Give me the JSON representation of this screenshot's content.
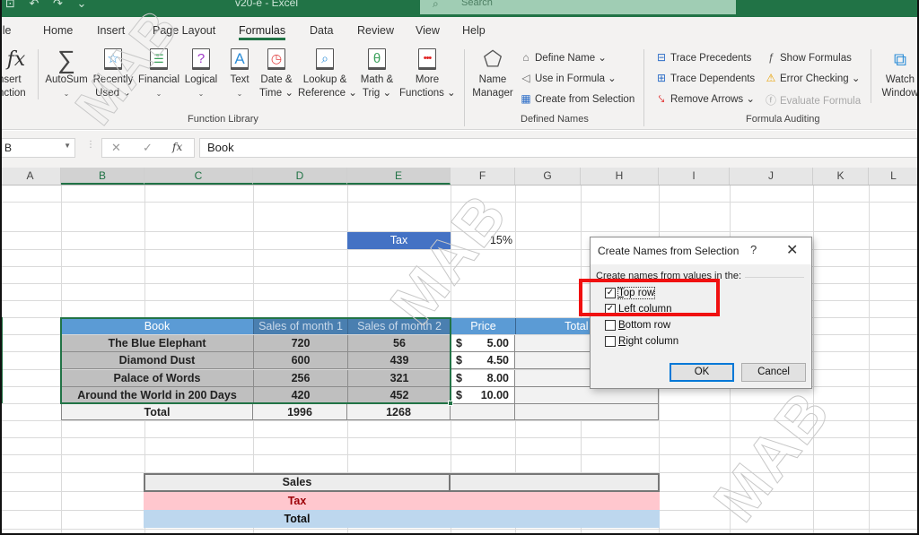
{
  "titlebar": {
    "quick_access": "⊡ ↶ ↷ ⌄",
    "title": "v20-e  -  Excel",
    "search_placeholder": "Search"
  },
  "ribbon": {
    "tabs": [
      {
        "label": "ile"
      },
      {
        "label": "Home"
      },
      {
        "label": "Insert"
      },
      {
        "label": "Page Layout"
      },
      {
        "label": "Formulas",
        "active": true
      },
      {
        "label": "Data"
      },
      {
        "label": "Review"
      },
      {
        "label": "View"
      },
      {
        "label": "Help"
      }
    ],
    "function_library": {
      "group_label": "Function Library",
      "insert_function": {
        "line1": "nsert",
        "line2": "nction",
        "icon": "fx"
      },
      "buttons": [
        {
          "line1": "AutoSum",
          "line2": "⌄",
          "icon": "sigma-icon"
        },
        {
          "line1": "Recently",
          "line2": "Used ⌄",
          "icon": "star-book-icon"
        },
        {
          "line1": "Financial",
          "line2": "⌄",
          "icon": "coins-book-icon"
        },
        {
          "line1": "Logical",
          "line2": "⌄",
          "icon": "question-book-icon"
        },
        {
          "line1": "Text",
          "line2": "⌄",
          "icon": "text-book-icon"
        },
        {
          "line1": "Date &",
          "line2": "Time ⌄",
          "icon": "clock-book-icon"
        },
        {
          "line1": "Lookup &",
          "line2": "Reference ⌄",
          "icon": "magnifier-book-icon"
        },
        {
          "line1": "Math &",
          "line2": "Trig ⌄",
          "icon": "theta-book-icon"
        },
        {
          "line1": "More",
          "line2": "Functions ⌄",
          "icon": "dots-book-icon"
        }
      ]
    },
    "defined_names": {
      "group_label": "Defined Names",
      "name_manager": {
        "line1": "Name",
        "line2": "Manager"
      },
      "define_name": "Define Name  ⌄",
      "use_in_formula": "Use in Formula ⌄",
      "create_from_selection": "Create from Selection"
    },
    "formula_auditing": {
      "group_label": "Formula Auditing",
      "trace_precedents": "Trace Precedents",
      "trace_dependents": "Trace Dependents",
      "remove_arrows": "Remove Arrows  ⌄",
      "show_formulas": "Show Formulas",
      "error_checking": "Error Checking  ⌄",
      "evaluate_formula": "Evaluate Formula"
    },
    "watch_window": {
      "line1": "Watch",
      "line2": "Window"
    }
  },
  "formula_bar": {
    "name_box": "B",
    "cancel": "✕",
    "enter": "✓",
    "fx": "fx",
    "value": "Book"
  },
  "columns": [
    "A",
    "B",
    "C",
    "D",
    "E",
    "F",
    "G",
    "H",
    "I",
    "J",
    "K",
    "L"
  ],
  "sheet": {
    "tax_label": "Tax",
    "tax_value": "15%",
    "table_headers": {
      "book": "Book",
      "sales_m1": "Sales of month 1",
      "sales_m2": "Sales of month 2",
      "price": "Price",
      "total_books": "Total boo"
    },
    "rows": [
      {
        "book": "The Blue Elephant",
        "m1": "720",
        "m2": "56",
        "currency": "$",
        "price": "5.00"
      },
      {
        "book": "Diamond Dust",
        "m1": "600",
        "m2": "439",
        "currency": "$",
        "price": "4.50"
      },
      {
        "book": "Palace of Words",
        "m1": "256",
        "m2": "321",
        "currency": "$",
        "price": "8.00"
      },
      {
        "book": "Around the World in 200 Days",
        "m1": "420",
        "m2": "452",
        "currency": "$",
        "price": "10.00"
      }
    ],
    "total_row": {
      "label": "Total",
      "m1": "1996",
      "m2": "1268"
    },
    "summary": {
      "sales": "Sales",
      "tax": "Tax",
      "total": "Total"
    }
  },
  "dialog": {
    "title": "Create Names from Selection",
    "help": "?",
    "close": "✕",
    "section_label": "Create names from values in the:",
    "options": [
      {
        "pre": "",
        "u": "T",
        "post": "op row",
        "checked": true
      },
      {
        "pre": "",
        "u": "L",
        "post": "eft column",
        "checked": true
      },
      {
        "pre": "",
        "u": "B",
        "post": "ottom row",
        "checked": false
      },
      {
        "pre": "",
        "u": "R",
        "post": "ight column",
        "checked": false
      }
    ],
    "ok": "OK",
    "cancel": "Cancel"
  },
  "watermark": "MAB",
  "colors": {
    "excel_green": "#217346",
    "table_header_blue": "#5b9bd5",
    "tax_blue": "#4472c4",
    "selected_gray": "#bfbfbf",
    "tax_pink": "#ffc7ce",
    "tax_text_red": "#9c0006",
    "total_blue": "#bdd7ee",
    "highlight_red": "#f01010"
  }
}
